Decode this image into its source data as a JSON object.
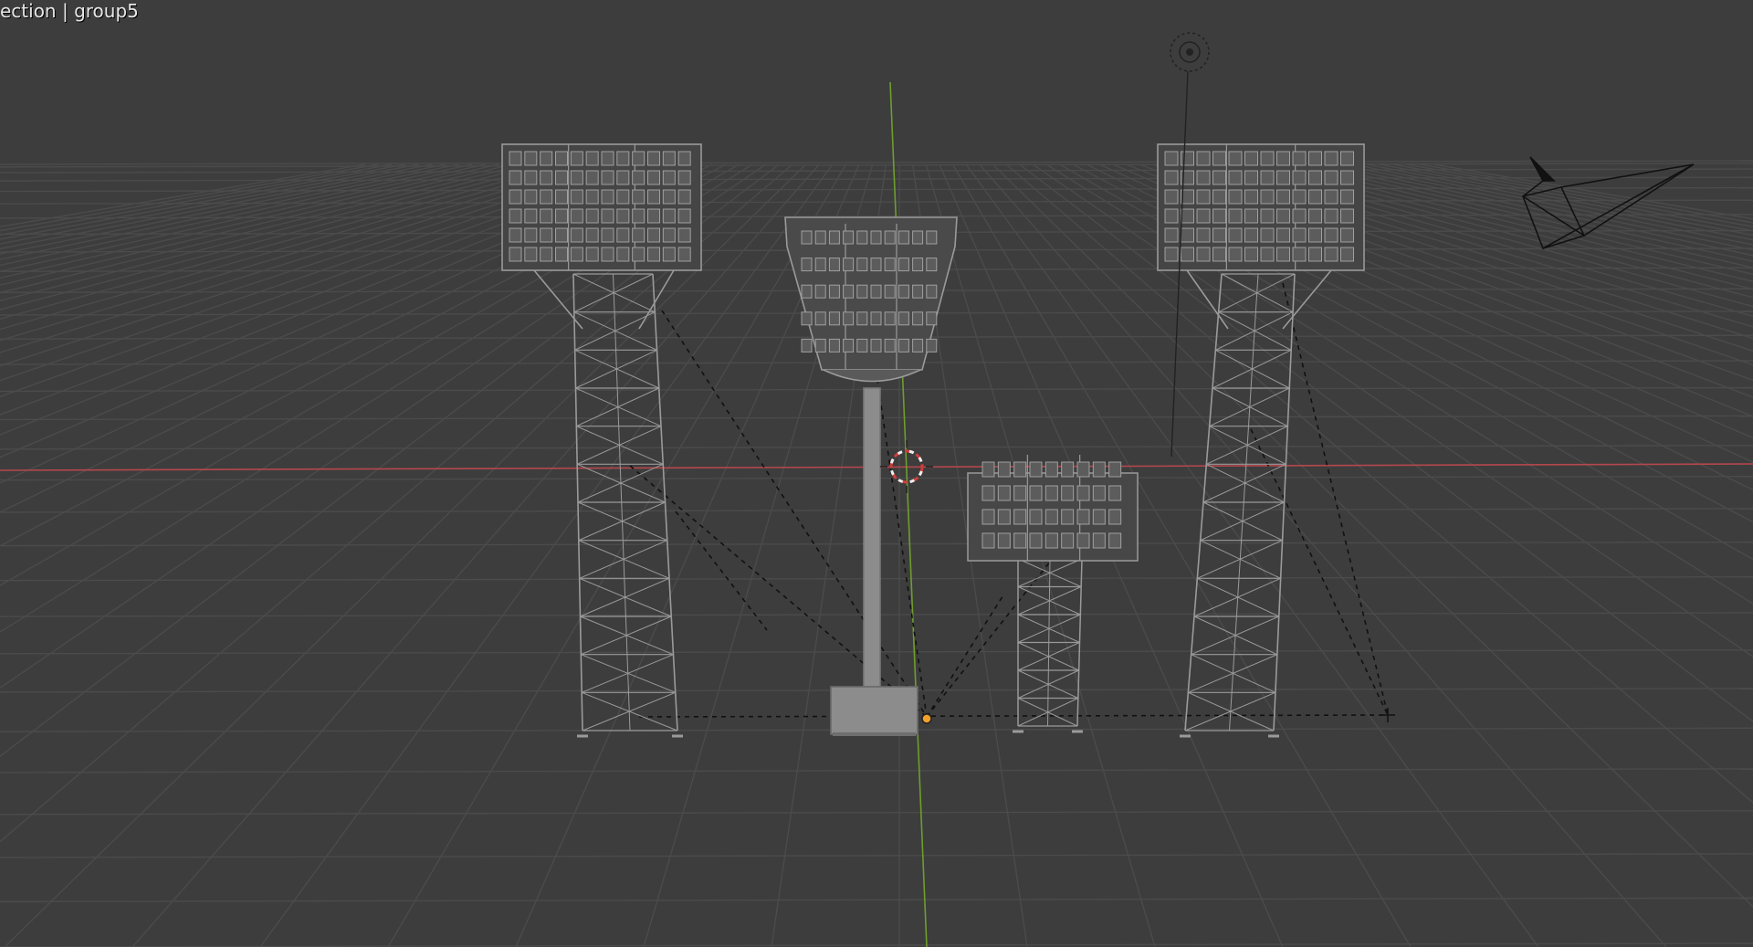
{
  "viewport": {
    "label": "ection | group5",
    "colors": {
      "background": "#3d3d3d",
      "grid_line": "#4b4b4b",
      "x_axis": "#b5474d",
      "y_axis": "#6e9d2d",
      "wireframe": "#9a9a9a",
      "solid": "#8c8c8c",
      "origin_dot": "#f5a02c",
      "cursor_red": "#d23c3c"
    },
    "objects": [
      {
        "name": "light-tower-left",
        "icon": "lattice-tower-floodlight"
      },
      {
        "name": "light-tower-pole",
        "icon": "single-pole-floodlight"
      },
      {
        "name": "light-tower-small",
        "icon": "small-lattice-floodlight"
      },
      {
        "name": "light-tower-right",
        "icon": "lattice-tower-floodlight"
      },
      {
        "name": "camera",
        "icon": "camera-wireframe"
      },
      {
        "name": "point-light",
        "icon": "light-source-icon"
      },
      {
        "name": "3d-cursor",
        "icon": "cursor-target-icon"
      }
    ]
  }
}
